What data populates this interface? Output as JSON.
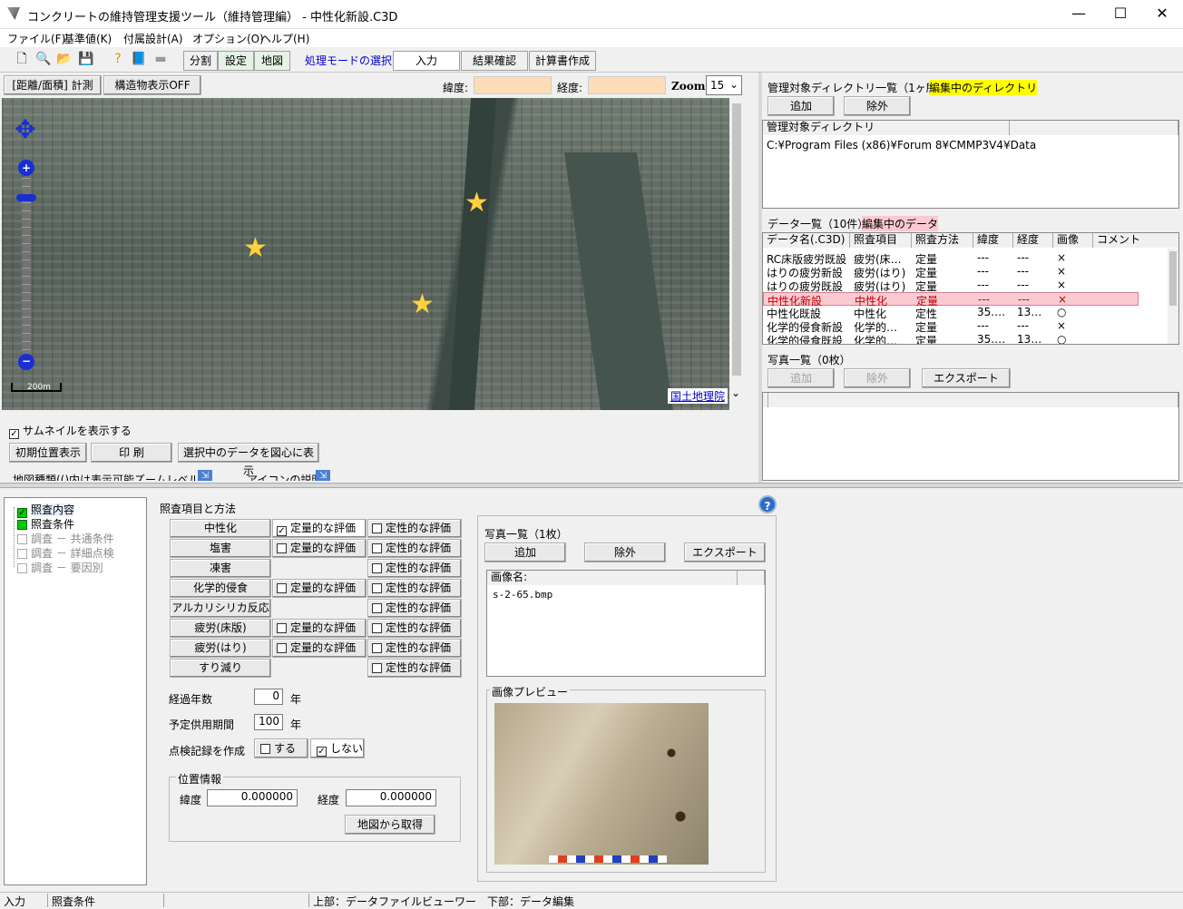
{
  "window": {
    "title": "コンクリートの維持管理支援ツール（維持管理編） - 中性化新設.C3D",
    "minimize": "—",
    "maximize": "☐",
    "close": "✕"
  },
  "menu": [
    "ファイル(F)",
    "基準値(K)",
    "付属設計(A)",
    "オプション(O)",
    "ヘルプ(H)"
  ],
  "toolbar": {
    "tabs": [
      "分割",
      "設定",
      "地図"
    ],
    "mode_label": "処理モードの選択",
    "modes": [
      "入力",
      "結果確認",
      "計算書作成"
    ]
  },
  "map": {
    "measure_button": "[距離/面積] 計測",
    "structure_button": "構造物表示OFF",
    "lat_label": "緯度:",
    "lon_label": "経度:",
    "zoom_label": "Zoom:",
    "zoom_value": "15",
    "scale_label": "200m",
    "credit": "国土地理院",
    "thumbnail_label": "サムネイルを表示する",
    "init_button": "初期位置表示",
    "print_button": "印 刷",
    "center_button": "選択中のデータを図心に表示",
    "map_type_label": "地図種類(()内は表示可能ズームレベル)",
    "icon_desc_label": "アイコンの説明"
  },
  "directory": {
    "title": "管理対象ディレクトリ一覧（1ヶ所）",
    "editing": "編集中のディレクトリ",
    "add": "追加",
    "remove": "除外",
    "header": "管理対象ディレクトリ",
    "path": "C:¥Program Files (x86)¥Forum 8¥CMMP3V4¥Data"
  },
  "data_list": {
    "title": "データ一覧（10件）",
    "editing": "編集中のデータ",
    "headers": [
      "データ名(.C3D)",
      "照査項目",
      "照査方法",
      "緯度",
      "経度",
      "画像",
      "コメント"
    ],
    "rows": [
      [
        "RC床版疲労既設",
        "疲労(床…",
        "定量",
        "---",
        "---",
        "×"
      ],
      [
        "はりの疲労新設",
        "疲労(はり)",
        "定量",
        "---",
        "---",
        "×"
      ],
      [
        "はりの疲労既設",
        "疲労(はり)",
        "定量",
        "---",
        "---",
        "×"
      ],
      [
        "中性化新設",
        "中性化",
        "定量",
        "---",
        "---",
        "×"
      ],
      [
        "中性化既設",
        "中性化",
        "定性",
        "35.…",
        "13…",
        "○"
      ],
      [
        "化学的侵食新設",
        "化学的…",
        "定量",
        "---",
        "---",
        "×"
      ],
      [
        "化学的侵食既設",
        "化学的…",
        "定量",
        "35.…",
        "13…",
        "○"
      ]
    ]
  },
  "photo_list": {
    "title": "写真一覧（0枚）",
    "add": "追加",
    "remove": "除外",
    "export": "エクスポート"
  },
  "tree": [
    "照査内容",
    "照査条件",
    "調査 － 共通条件",
    "調査 － 詳細点検",
    "調査 － 要因別"
  ],
  "check": {
    "title": "照査項目と方法",
    "items": [
      {
        "name": "中性化",
        "quant": "定量的な評価",
        "qual": "定性的な評価"
      },
      {
        "name": "塩害",
        "quant": "定量的な評価",
        "qual": "定性的な評価"
      },
      {
        "name": "凍害",
        "quant": "",
        "qual": "定性的な評価"
      },
      {
        "name": "化学的侵食",
        "quant": "定量的な評価",
        "qual": "定性的な評価"
      },
      {
        "name": "アルカリシリカ反応",
        "quant": "",
        "qual": "定性的な評価"
      },
      {
        "name": "疲労(床版)",
        "quant": "定量的な評価",
        "qual": "定性的な評価"
      },
      {
        "name": "疲労(はり)",
        "quant": "定量的な評価",
        "qual": "定性的な評価"
      },
      {
        "name": "すり減り",
        "quant": "",
        "qual": "定性的な評価"
      }
    ],
    "years_label": "経過年数",
    "years_value": "0",
    "years_unit": "年",
    "service_label": "予定供用期間",
    "service_value": "100",
    "service_unit": "年",
    "record_label": "点検記録を作成",
    "record_yes": "する",
    "record_no": "しない",
    "position_title": "位置情報",
    "lat_label": "緯度",
    "lat_value": "0.000000",
    "lon_label": "経度",
    "lon_value": "0.000000",
    "from_map": "地図から取得"
  },
  "photos": {
    "title": "写真一覧（1枚）",
    "add": "追加",
    "remove": "除外",
    "export": "エクスポート",
    "header": "画像名:",
    "file": "s-2-65.bmp",
    "preview_title": "画像プレビュー"
  },
  "statusbar": [
    "入力",
    "照査条件",
    "上部：データファイルビューワー　下部：データ編集"
  ]
}
